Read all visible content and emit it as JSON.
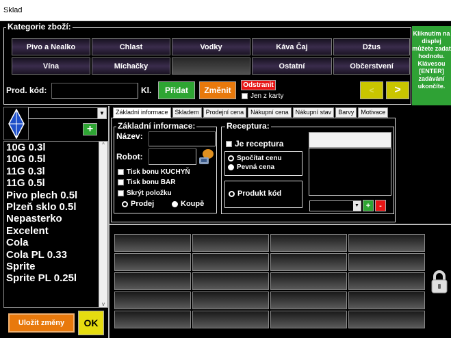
{
  "window": {
    "title": "Sklad"
  },
  "categories": {
    "legend": "Kategorie zboží:",
    "row1": [
      "Pivo a Nealko",
      "Chlast",
      "Vodky",
      "Káva Čaj",
      "Džus"
    ],
    "row2": [
      "Vína",
      "Míchačky",
      "",
      "Ostatní",
      "Občerstvení"
    ]
  },
  "hint": {
    "text": "Kliknutím na displej můžete zadat hodnotu. Klávesou [ENTER] zadávání ukončíte."
  },
  "product_code": {
    "label": "Prod. kód:",
    "value": "",
    "unit_label": "Kl.",
    "add_label": "Přidat",
    "change_label": "Změnit",
    "remove_label": "Odstranit",
    "only_card_label": "Jen z karty",
    "prev_label": "<",
    "next_label": ">"
  },
  "colors": {
    "add": "#2ea533",
    "change": "#e8790c",
    "remove": "#e81515",
    "hint_bg": "#2fa235",
    "save": "#e8790c",
    "ok": "#e6dc10"
  },
  "sidebar": {
    "filter_value": "",
    "add_label": "+",
    "items": [
      "10G 0.3l",
      "10G 0.5l",
      "11G 0.3l",
      "11G 0.5l",
      "Pivo plech 0.5l",
      "Plzeň sklo 0.5l",
      "Nepasterko",
      "Excelent",
      "Cola",
      "Cola PL 0.33",
      "Sprite",
      "Sprite PL 0.25l"
    ],
    "save_label": "Uložit změny",
    "ok_label": "OK"
  },
  "tabs": [
    "Základní informace",
    "Skladem",
    "Prodejní cena",
    "Nákupní cena",
    "Nákupní stav",
    "Barvy",
    "Motivace"
  ],
  "basic_info": {
    "legend": "Základní informace:",
    "name_label": "Název:",
    "name_value": "",
    "robot_label": "Robot:",
    "robot_value": "",
    "print_kitchen": "Tisk bonu KUCHYŇ",
    "print_bar": "Tisk bonu BAR",
    "hide_item": "Skrýt položku",
    "sale_label": "Prodej",
    "purchase_label": "Koupě"
  },
  "recipe": {
    "legend": "Receptura:",
    "is_recipe_label": "Je receptura",
    "calc_price_label": "Spočítat cenu",
    "fixed_price_label": "Pevná cena",
    "product_code_label": "Produkt kód",
    "select_value": "",
    "add_label": "+",
    "remove_label": "-"
  },
  "icons": {
    "robot": "robot-icon",
    "lock": "padlock-icon",
    "left_logo": "blue-diamond-icon"
  }
}
